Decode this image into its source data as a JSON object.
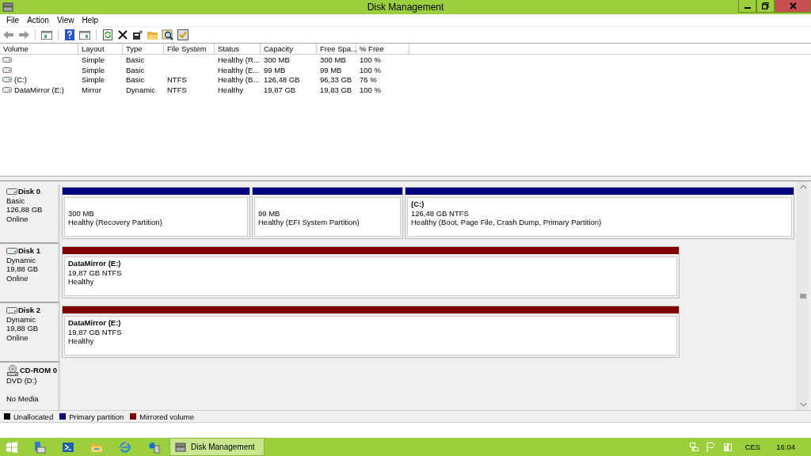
{
  "window": {
    "title": "Disk Management"
  },
  "menu": [
    "File",
    "Action",
    "View",
    "Help"
  ],
  "table": {
    "columns": [
      "Volume",
      "Layout",
      "Type",
      "File System",
      "Status",
      "Capacity",
      "Free Spa...",
      "% Free"
    ],
    "rows": [
      {
        "cells": [
          "",
          "Simple",
          "Basic",
          "",
          "Healthy (R...",
          "300 MB",
          "300 MB",
          "100 %"
        ]
      },
      {
        "cells": [
          "",
          "Simple",
          "Basic",
          "",
          "Healthy (E...",
          "99 MB",
          "99 MB",
          "100 %"
        ]
      },
      {
        "cells": [
          "(C:)",
          "Simple",
          "Basic",
          "NTFS",
          "Healthy (B...",
          "126,48 GB",
          "96,33 GB",
          "76 %"
        ]
      },
      {
        "cells": [
          "DataMirror (E:)",
          "Mirror",
          "Dynamic",
          "NTFS",
          "Healthy",
          "19,87 GB",
          "19,83 GB",
          "100 %"
        ]
      }
    ]
  },
  "disks": [
    {
      "kind": "disk",
      "name": "Disk 0",
      "lines": [
        "Basic",
        "126,88 GB",
        "Online"
      ],
      "partitions": [
        {
          "kind": "primary",
          "lines": [
            "300 MB",
            "Healthy (Recovery Partition)"
          ]
        },
        {
          "kind": "primary",
          "lines": [
            "99 MB",
            "Healthy (EFI System Partition)"
          ]
        },
        {
          "kind": "primary",
          "title": "(C:)",
          "lines": [
            "126,48 GB NTFS",
            "Healthy (Boot, Page File, Crash Dump, Primary Partition)"
          ]
        }
      ]
    },
    {
      "kind": "disk",
      "name": "Disk 1",
      "lines": [
        "Dynamic",
        "19,88 GB",
        "Online"
      ],
      "partitions": [
        {
          "kind": "mirrored",
          "title": "DataMirror  (E:)",
          "lines": [
            "19,87 GB NTFS",
            "Healthy"
          ]
        }
      ]
    },
    {
      "kind": "disk",
      "name": "Disk 2",
      "lines": [
        "Dynamic",
        "19,88 GB",
        "Online"
      ],
      "partitions": [
        {
          "kind": "mirrored",
          "title": "DataMirror  (E:)",
          "lines": [
            "19,87 GB NTFS",
            "Healthy"
          ]
        }
      ]
    },
    {
      "kind": "cdrom",
      "name": "CD-ROM 0",
      "lines": [
        "DVD (D:)"
      ],
      "status": "No Media"
    }
  ],
  "legend": [
    {
      "label": "Unallocated",
      "color": "#000000"
    },
    {
      "label": "Primary partition",
      "color": "#000080"
    },
    {
      "label": "Mirrored volume",
      "color": "#800000"
    }
  ],
  "taskbar": {
    "task": {
      "label": "Disk Management",
      "selected": true
    },
    "language": "CES",
    "time": "16:04"
  }
}
